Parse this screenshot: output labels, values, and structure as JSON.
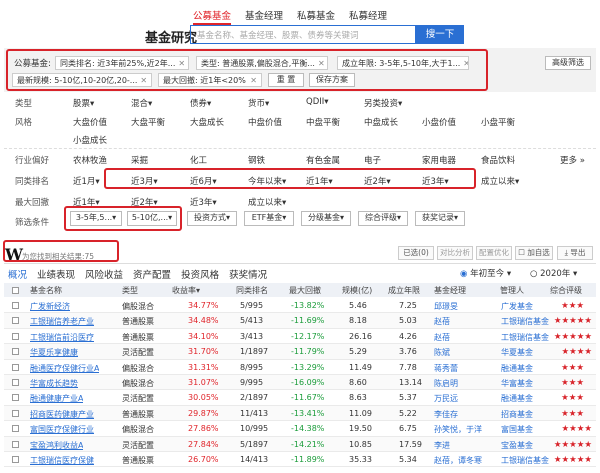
{
  "header": {
    "title": "基金研究",
    "tabs": [
      "公募基金",
      "基金经理",
      "私募基金",
      "私募经理"
    ],
    "search_placeholder": "基金名称、基金经理、股票、债券等关键词",
    "search_button": "搜一下"
  },
  "filter": {
    "label_public": "公募基金:",
    "chip_rank": "同类排名: 近3年前25%,近2年...",
    "chip_type": "类型: 普通股票,偏股混合,平衡...",
    "chip_age": "成立年限: 3-5年,5-10年,大于1...",
    "chip_scale": "最新规模: 5-10亿,10-20亿,20-...",
    "chip_drawdown": "最大回撤: 近1年<20%",
    "reset": "重 置",
    "save": "保存方案",
    "advanced": "高级筛选"
  },
  "criteria": {
    "type_label": "类型",
    "types": [
      "股票",
      "混合",
      "债券",
      "货币",
      "QDII",
      "另类投资"
    ],
    "style_label": "风格",
    "styles_row1": [
      "大盘价值",
      "大盘平衡",
      "大盘成长",
      "中盘价值",
      "中盘平衡",
      "中盘成长",
      "小盘价值",
      "小盘平衡"
    ],
    "styles_row2": [
      "小盘成长"
    ],
    "industry_label": "行业偏好",
    "industries": [
      "农林牧渔",
      "采掘",
      "化工",
      "钢铁",
      "有色金属",
      "电子",
      "家用电器",
      "食品饮料"
    ],
    "more": "更多",
    "rank_label": "同类排名",
    "ranks": [
      "近1月",
      "近3月",
      "近6月",
      "今年以来",
      "近1年",
      "近2年",
      "近3年",
      "成立以来"
    ],
    "drawdown_label": "最大回撤",
    "drawdowns": [
      "近1年",
      "近2年",
      "近3年",
      "成立以来"
    ],
    "cond_label": "筛选条件",
    "conds": [
      "3-5年,5...",
      "5-10亿,...",
      "投资方式",
      "ETF基金",
      "分级基金",
      "综合评级",
      "获奖记录"
    ]
  },
  "results": {
    "logo": "W",
    "text": "为您找到相关结果:75",
    "btn_chosen": "已选(0)",
    "btn_compare": "对比分析",
    "btn_config": "配置优化",
    "btn_add": "加自选",
    "btn_export": "导出"
  },
  "tabs": [
    "概况",
    "业绩表现",
    "风险收益",
    "资产配置",
    "投资风格",
    "获奖情况"
  ],
  "period": {
    "option1": "年初至今",
    "option2": "2020年"
  },
  "table": {
    "headers": [
      "基金名称",
      "类型",
      "收益率",
      "同类排名",
      "最大回撤",
      "规模(亿)",
      "成立年限",
      "基金经理",
      "管理人",
      "综合评级"
    ],
    "rows": [
      {
        "name": "广发新经济",
        "type": "偏股混合",
        "ret": "34.77%",
        "rank": "5/995",
        "dd": "-13.82%",
        "scale": "5.46",
        "age": "7.25",
        "mgr": "邱璟旻",
        "co": "广发基金",
        "stars": 3
      },
      {
        "name": "工银瑞信养老产业",
        "type": "普通股票",
        "ret": "34.48%",
        "rank": "5/413",
        "dd": "-11.69%",
        "scale": "8.18",
        "age": "5.03",
        "mgr": "赵蓓",
        "co": "工银瑞信基金",
        "stars": 5
      },
      {
        "name": "工银瑞信前沿医疗",
        "type": "普通股票",
        "ret": "34.10%",
        "rank": "3/413",
        "dd": "-12.17%",
        "scale": "26.16",
        "age": "4.26",
        "mgr": "赵蓓",
        "co": "工银瑞信基金",
        "stars": 5
      },
      {
        "name": "华夏乐享健康",
        "type": "灵活配置",
        "ret": "31.70%",
        "rank": "1/1897",
        "dd": "-11.79%",
        "scale": "5.29",
        "age": "3.76",
        "mgr": "陈斌",
        "co": "华夏基金",
        "stars": 4
      },
      {
        "name": "融通医疗保健行业A",
        "type": "偏股混合",
        "ret": "31.31%",
        "rank": "8/995",
        "dd": "-13.29%",
        "scale": "11.49",
        "age": "7.78",
        "mgr": "蒋秀蕾",
        "co": "融通基金",
        "stars": 3
      },
      {
        "name": "华富成长趋势",
        "type": "偏股混合",
        "ret": "31.07%",
        "rank": "9/995",
        "dd": "-16.09%",
        "scale": "8.60",
        "age": "13.14",
        "mgr": "陈启明",
        "co": "华富基金",
        "stars": 3
      },
      {
        "name": "融通健康产业A",
        "type": "灵活配置",
        "ret": "30.05%",
        "rank": "2/1897",
        "dd": "-11.67%",
        "scale": "8.63",
        "age": "5.37",
        "mgr": "万民远",
        "co": "融通基金",
        "stars": 3
      },
      {
        "name": "招商医药健康产业",
        "type": "普通股票",
        "ret": "29.87%",
        "rank": "11/413",
        "dd": "-13.41%",
        "scale": "11.09",
        "age": "5.22",
        "mgr": "李佳存",
        "co": "招商基金",
        "stars": 3
      },
      {
        "name": "富国医疗保健行业",
        "type": "偏股混合",
        "ret": "27.86%",
        "rank": "10/995",
        "dd": "-14.38%",
        "scale": "19.50",
        "age": "6.75",
        "mgr": "孙笑悦，于洋",
        "co": "富国基金",
        "stars": 4
      },
      {
        "name": "宝盈鸿利收益A",
        "type": "灵活配置",
        "ret": "27.84%",
        "rank": "5/1897",
        "dd": "-14.21%",
        "scale": "10.85",
        "age": "17.59",
        "mgr": "李进",
        "co": "宝盈基金",
        "stars": 5
      },
      {
        "name": "工银瑞信医疗保健",
        "type": "普通股票",
        "ret": "26.70%",
        "rank": "14/413",
        "dd": "-11.89%",
        "scale": "35.33",
        "age": "5.34",
        "mgr": "赵蓓，谭冬寒",
        "co": "工银瑞信基金",
        "stars": 5
      }
    ]
  },
  "colors": {
    "accent": "#2a6fd3",
    "red": "#e0242a",
    "green": "#1b9c3a",
    "highlight": "#d8232a"
  }
}
